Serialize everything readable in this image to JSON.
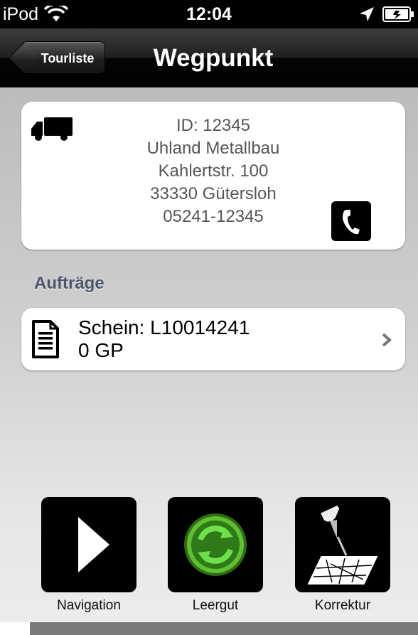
{
  "status_bar": {
    "carrier": "iPod",
    "time": "12:04",
    "icons": [
      "wifi-icon",
      "location-arrow-icon",
      "battery-icon"
    ]
  },
  "nav": {
    "back_label": "Tourliste",
    "title": "Wegpunkt"
  },
  "waypoint": {
    "icon": "truck-icon",
    "id_line": "ID: 12345",
    "name": "Uhland Metallbau",
    "street": "Kahlertstr. 100",
    "city": "33330 Gütersloh",
    "phone": "05241-12345",
    "phone_icon": "phone-icon"
  },
  "orders": {
    "section_title": "Aufträge",
    "items": [
      {
        "icon": "document-icon",
        "title": "Schein: L10014241",
        "subtitle": "0 GP"
      }
    ]
  },
  "actions": [
    {
      "label": "Navigation",
      "icon": "play-icon"
    },
    {
      "label": "Leergut",
      "icon": "recycle-icon",
      "accent": "#5fbf2f"
    },
    {
      "label": "Korrektur",
      "icon": "map-pin-icon"
    }
  ]
}
